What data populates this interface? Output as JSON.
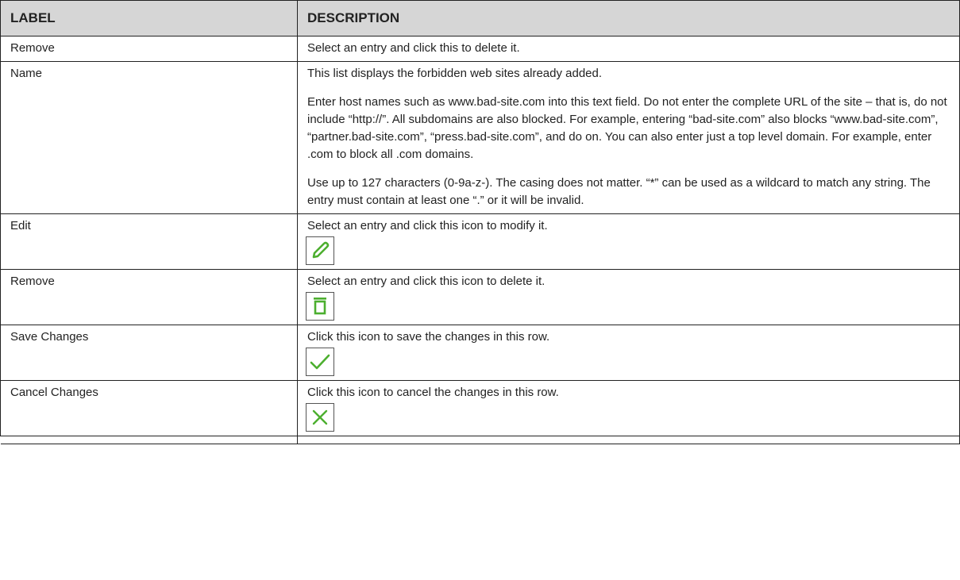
{
  "header": {
    "label": "LABEL",
    "description": "DESCRIPTION"
  },
  "rows": [
    {
      "label": "Remove",
      "desc": [
        "Select an entry and click this to delete it."
      ]
    },
    {
      "label": "Name",
      "desc": [
        "This list displays the forbidden web sites already added.",
        "Enter host names such as www.bad-site.com into this text field. Do not enter the complete URL of the site – that is, do not include “http://”. All subdomains are also blocked. For example, entering “bad-site.com” also blocks “www.bad-site.com”, “partner.bad-site.com”, “press.bad-site.com”, and do on. You can also enter just a top level domain. For example, enter .com to block all .com domains.",
        "Use up to 127 characters (0-9a-z-). The casing does not matter. “*” can be used as a wildcard to match any string. The entry must contain at least one “.” or it will be invalid."
      ]
    },
    {
      "label": "Edit",
      "desc": [
        "Select an entry and click this icon to modify it."
      ],
      "icon": "pencil-icon"
    },
    {
      "label": "Remove",
      "desc": [
        "Select an entry and click this icon to delete it."
      ],
      "icon": "trash-icon"
    },
    {
      "label": "Save Changes",
      "desc": [
        "Click this icon to save the changes in this row."
      ],
      "icon": "checkmark-icon"
    },
    {
      "label": "Cancel Changes",
      "desc": [
        "Click this icon to cancel the changes in this row."
      ],
      "icon": "close-icon"
    }
  ],
  "colors": {
    "header_bg": "#d6d6d6",
    "icon_green": "#4caf2f",
    "border": "#222222"
  }
}
